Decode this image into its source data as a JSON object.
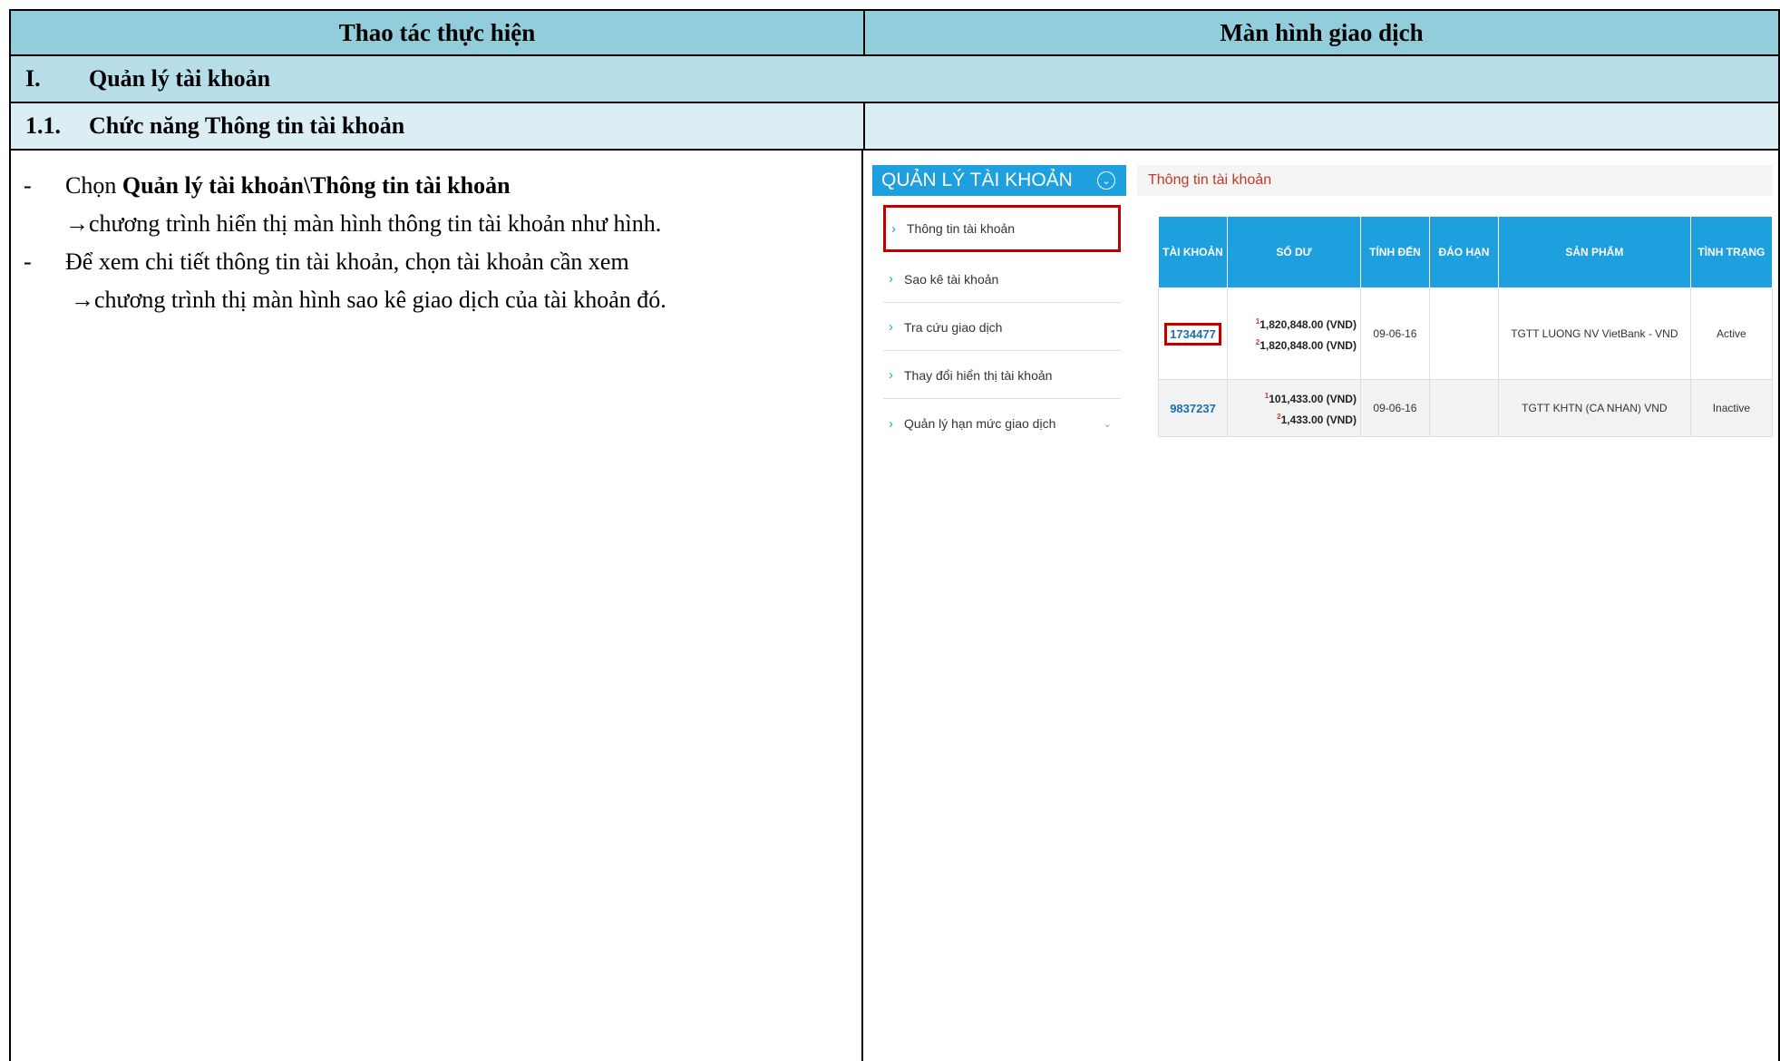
{
  "header": {
    "col1": "Thao tác thực hiện",
    "col2": "Màn hình giao dịch"
  },
  "section": {
    "num": "I.",
    "title": "Quản lý tài khoản"
  },
  "subsection": {
    "num": "1.1.",
    "title": "Chức năng Thông tin tài khoản"
  },
  "instructions": {
    "line1_pre": "Chọn ",
    "line1_bold": "Quản lý tài khoản\\Thông tin tài khoản",
    "line2": "→chương trình hiển thị màn hình thông tin tài khoản như hình.",
    "line3": "Để xem chi tiết thông tin tài khoản, chọn tài khoản cần xem",
    "line4": "→chương trình thị màn hình sao kê giao dịch của tài khoản đó."
  },
  "screen": {
    "menu_title": "QUẢN LÝ TÀI KHOẢN",
    "menu_items": [
      {
        "label": "Thông tin tài khoản"
      },
      {
        "label": "Sao kê tài khoản"
      },
      {
        "label": "Tra cứu giao dịch"
      },
      {
        "label": "Thay đổi hiển thị tài khoản"
      },
      {
        "label": "Quản lý hạn mức giao dịch"
      }
    ],
    "page_title": "Thông tin tài khoản",
    "columns": [
      "TÀI KHOẢN",
      "SỐ DƯ",
      "TÍNH ĐẾN",
      "ĐÁO HẠN",
      "SẢN PHẨM",
      "TÌNH TRẠNG"
    ],
    "rows": [
      {
        "account": "1734477",
        "bal1": "1,820,848.00 (VND)",
        "bal2": "1,820,848.00 (VND)",
        "date": "09-06-16",
        "due": "",
        "product": "TGTT LUONG NV VietBank - VND",
        "status": "Active"
      },
      {
        "account": "9837237",
        "bal1": "101,433.00 (VND)",
        "bal2": "1,433.00 (VND)",
        "date": "09-06-16",
        "due": "",
        "product": "TGTT KHTN (CA NHAN) VND",
        "status": "Inactive"
      }
    ]
  }
}
